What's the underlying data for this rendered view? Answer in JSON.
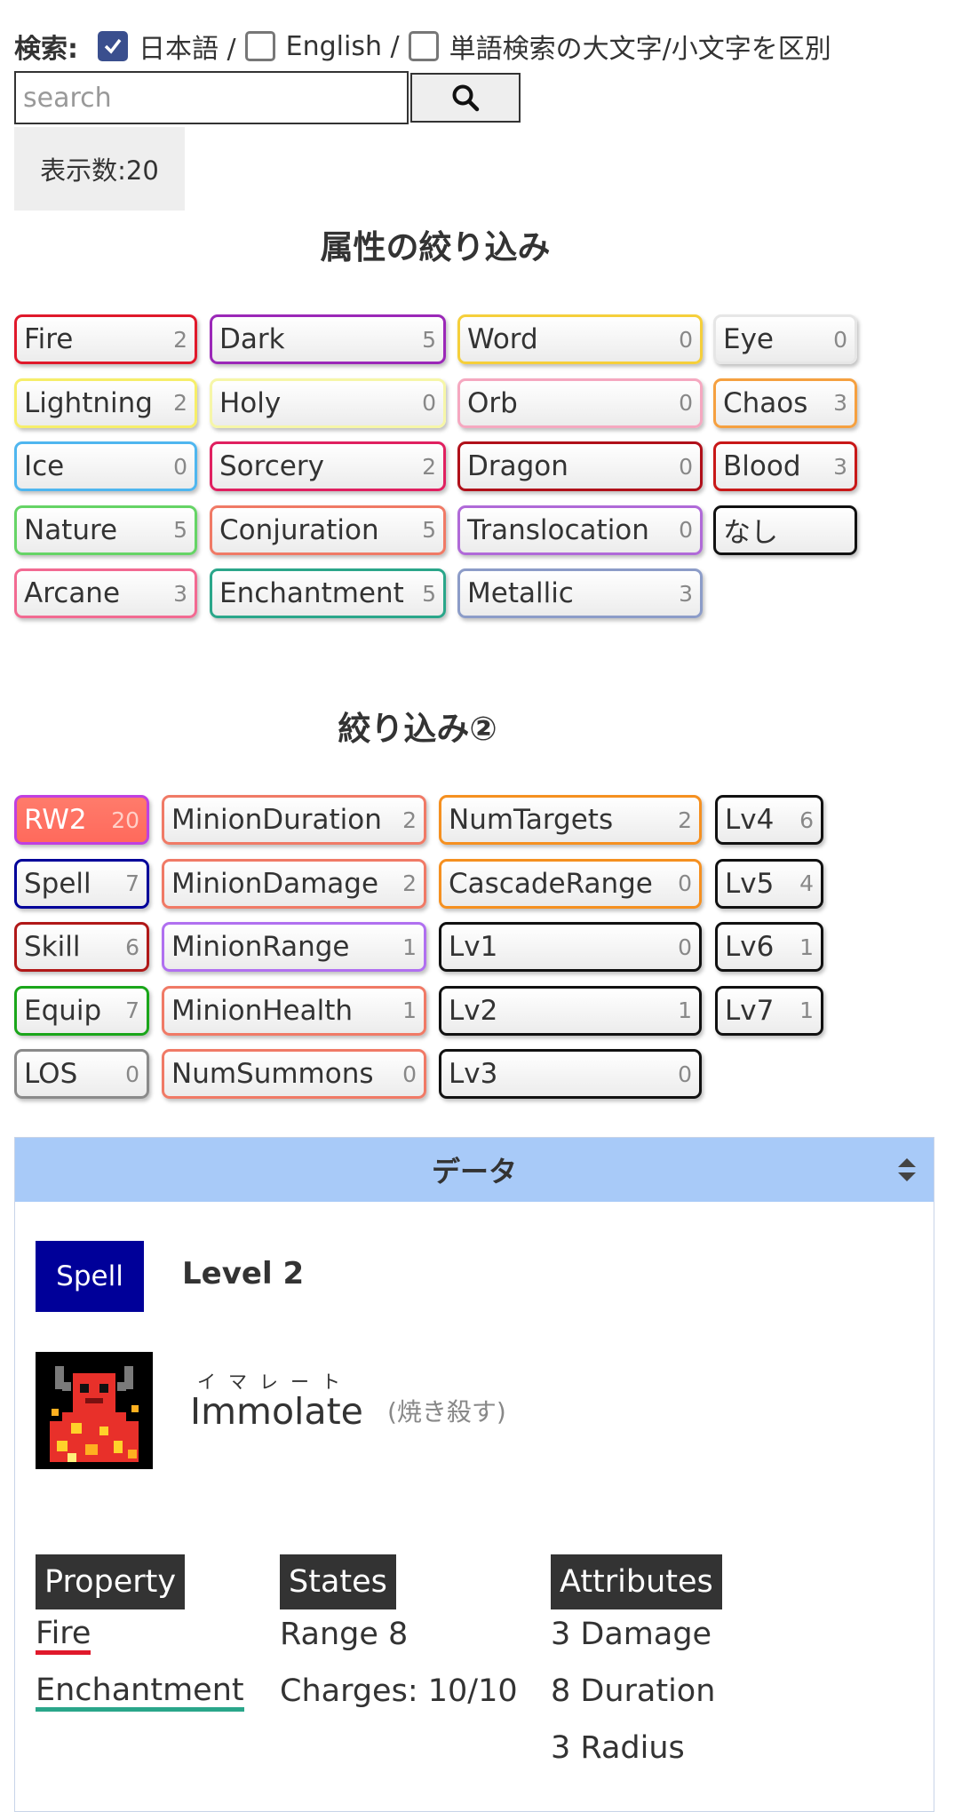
{
  "search": {
    "label": "検索:",
    "options": [
      {
        "label": "日本語 /",
        "checked": true
      },
      {
        "label": "English /",
        "checked": false
      },
      {
        "label": "単語検索の大文字/小文字を区別",
        "checked": false
      }
    ],
    "placeholder": "search",
    "value": "",
    "button_icon": "search-icon"
  },
  "display_count": "表示数:20",
  "attribute_filter": {
    "title": "属性の絞り込み",
    "tags": [
      {
        "label": "Fire",
        "count": "2",
        "color": "#e0192b"
      },
      {
        "label": "Dark",
        "count": "5",
        "color": "#9b28b8"
      },
      {
        "label": "Word",
        "count": "0",
        "color": "#f5cf3b"
      },
      {
        "label": "Eye",
        "count": "0",
        "color": "#e6e6e6"
      },
      {
        "label": "Lightning",
        "count": "2",
        "color": "#f6ee6a"
      },
      {
        "label": "Holy",
        "count": "0",
        "color": "#f6f6a8"
      },
      {
        "label": "Orb",
        "count": "0",
        "color": "#f5a8c0"
      },
      {
        "label": "Chaos",
        "count": "3",
        "color": "#f5a040"
      },
      {
        "label": "Ice",
        "count": "0",
        "color": "#4fb6ef"
      },
      {
        "label": "Sorcery",
        "count": "2",
        "color": "#e02060"
      },
      {
        "label": "Dragon",
        "count": "0",
        "color": "#b0101a"
      },
      {
        "label": "Blood",
        "count": "3",
        "color": "#c81818"
      },
      {
        "label": "Nature",
        "count": "5",
        "color": "#66d466"
      },
      {
        "label": "Conjuration",
        "count": "5",
        "color": "#f07a66"
      },
      {
        "label": "Translocation",
        "count": "0",
        "color": "#b06ad8"
      },
      {
        "label": "なし",
        "count": "",
        "color": "#111111"
      },
      {
        "label": "Arcane",
        "count": "3",
        "color": "#f26a92"
      },
      {
        "label": "Enchantment",
        "count": "5",
        "color": "#2aa68a"
      },
      {
        "label": "Metallic",
        "count": "3",
        "color": "#8c9cc8"
      }
    ]
  },
  "filter2": {
    "title": "絞り込み②",
    "tags": [
      {
        "label": "RW2",
        "count": "20",
        "color": "#c040e0",
        "active": true
      },
      {
        "label": "MinionDuration",
        "count": "2",
        "color": "#f07a66"
      },
      {
        "label": "NumTargets",
        "count": "2",
        "color": "#f59020"
      },
      {
        "label": "Lv4",
        "count": "6",
        "color": "#111111"
      },
      {
        "label": "Spell",
        "count": "7",
        "color": "#000099"
      },
      {
        "label": "MinionDamage",
        "count": "2",
        "color": "#f07a66"
      },
      {
        "label": "CascadeRange",
        "count": "0",
        "color": "#f59020"
      },
      {
        "label": "Lv5",
        "count": "4",
        "color": "#111111"
      },
      {
        "label": "Skill",
        "count": "6",
        "color": "#b01818"
      },
      {
        "label": "MinionRange",
        "count": "1",
        "color": "#b070f0"
      },
      {
        "label": "Lv1",
        "count": "0",
        "color": "#111111"
      },
      {
        "label": "Lv6",
        "count": "1",
        "color": "#111111"
      },
      {
        "label": "Equip",
        "count": "7",
        "color": "#1aa61a"
      },
      {
        "label": "MinionHealth",
        "count": "1",
        "color": "#f07a66"
      },
      {
        "label": "Lv2",
        "count": "1",
        "color": "#111111"
      },
      {
        "label": "Lv7",
        "count": "1",
        "color": "#111111"
      },
      {
        "label": "LOS",
        "count": "0",
        "color": "#8a8a8a"
      },
      {
        "label": "NumSummons",
        "count": "0",
        "color": "#f07a66"
      },
      {
        "label": "Lv3",
        "count": "0",
        "color": "#111111"
      }
    ]
  },
  "data_panel": {
    "title": "データ",
    "sort_icon": "sort-icon",
    "card": {
      "type": "Spell",
      "level": "Level 2",
      "ruby": "イマレート",
      "name": "Immolate",
      "jp_name": "(焼き殺す)",
      "property_header": "Property",
      "properties": [
        {
          "label": "Fire",
          "color": "#e0192b"
        },
        {
          "label": "Enchantment",
          "color": "#2aa68a"
        }
      ],
      "states_header": "States",
      "states": [
        "Range 8",
        "Charges: 10/10"
      ],
      "attributes_header": "Attributes",
      "attributes": [
        "3 Damage",
        "8 Duration",
        "3 Radius"
      ]
    }
  }
}
